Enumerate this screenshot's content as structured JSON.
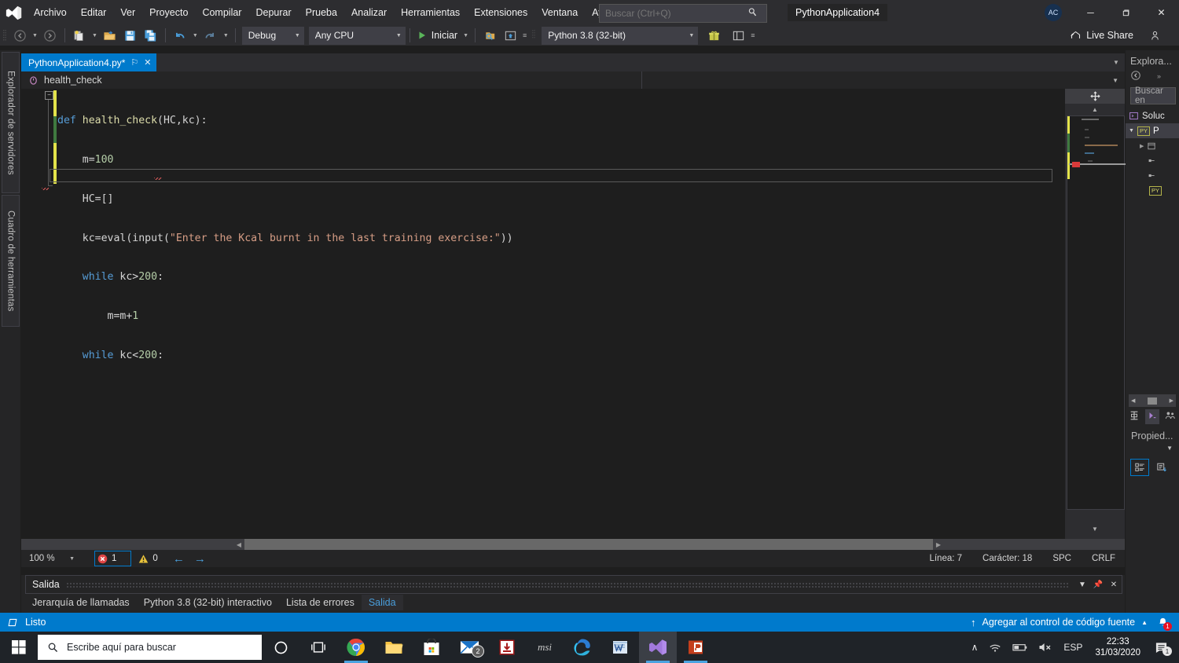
{
  "titlebar": {
    "logo_icon": "visual-studio-logo",
    "menus": [
      "Archivo",
      "Editar",
      "Ver",
      "Proyecto",
      "Compilar",
      "Depurar",
      "Prueba",
      "Analizar",
      "Herramientas",
      "Extensiones",
      "Ventana",
      "Ayuda"
    ],
    "search_placeholder": "Buscar (Ctrl+Q)",
    "search_value": "",
    "solution_name": "PythonApplication4",
    "account_initials": "AC",
    "minimize": "─",
    "restore": "❐",
    "close": "✕"
  },
  "toolbar": {
    "back_title": "Navegar hacia atrás",
    "forward_title": "Navegar hacia delante",
    "config": "Debug",
    "platform": "Any CPU",
    "start_label": "Iniciar",
    "interpreter": "Python 3.8 (32-bit)",
    "live_share": "Live Share"
  },
  "left_rail": {
    "tabs": [
      "Explorador de servidores",
      "Cuadro de herramientas"
    ]
  },
  "editor": {
    "tab_name": "PythonApplication4.py*",
    "tab_pin": "⚐",
    "tab_close": "✕",
    "breadcrumb_scope": "health_check",
    "code_lines": [
      {
        "indent": 0,
        "tokens": [
          {
            "t": "def ",
            "c": "kw"
          },
          {
            "t": "health_check",
            "c": "fn"
          },
          {
            "t": "(HC,kc):",
            "c": ""
          }
        ]
      },
      {
        "indent": 1,
        "tokens": [
          {
            "t": "m=",
            "c": ""
          },
          {
            "t": "100",
            "c": "num"
          }
        ]
      },
      {
        "indent": 1,
        "tokens": [
          {
            "t": "HC=[]",
            "c": ""
          }
        ]
      },
      {
        "indent": 1,
        "tokens": [
          {
            "t": "kc=eval(input(",
            "c": ""
          },
          {
            "t": "\"Enter the Kcal burnt in the last training exercise:\"",
            "c": "str"
          },
          {
            "t": "))",
            "c": ""
          }
        ]
      },
      {
        "indent": 1,
        "tokens": [
          {
            "t": "while ",
            "c": "kw"
          },
          {
            "t": "kc>",
            "c": ""
          },
          {
            "t": "200",
            "c": "num"
          },
          {
            "t": ":",
            "c": ""
          }
        ]
      },
      {
        "indent": 2,
        "tokens": [
          {
            "t": "m=m+",
            "c": ""
          },
          {
            "t": "1",
            "c": "num"
          }
        ]
      },
      {
        "indent": 1,
        "tokens": [
          {
            "t": "while ",
            "c": "kw"
          },
          {
            "t": "kc<",
            "c": ""
          },
          {
            "t": "200",
            "c": "num"
          },
          {
            "t": ":",
            "c": ""
          }
        ]
      }
    ],
    "zoom": "100 %",
    "error_count": "1",
    "warning_count": "0",
    "line_status": "Línea: 7",
    "char_status": "Carácter: 18",
    "spaces_status": "SPC",
    "eol_status": "CRLF"
  },
  "output_panel": {
    "title": "Salida",
    "dropdown_icon": "chevron-down-icon",
    "pin_icon": "pin-icon",
    "close_icon": "close-icon",
    "tabs": [
      "Jerarquía de llamadas",
      "Python 3.8 (32-bit) interactivo",
      "Lista de errores",
      "Salida"
    ],
    "active_tab": "Salida"
  },
  "right_dock": {
    "explorer_title": "Explora...",
    "search_placeholder": "Buscar en",
    "solution_row": "Soluc",
    "project_row": "P",
    "project_badge": "PY",
    "child_rows": [
      "",
      "",
      "",
      ""
    ],
    "properties_title": "Propied..."
  },
  "status_bar": {
    "ready": "Listo",
    "source_control": "Agregar al control de código fuente",
    "notification_count": "1"
  },
  "taskbar": {
    "start_icon": "windows-start-icon",
    "search_placeholder": "Escribe aquí para buscar",
    "cortana_icon": "cortana-circle-icon",
    "taskview_icon": "task-view-icon",
    "apps": [
      {
        "name": "chrome",
        "label": "Google Chrome",
        "badge": ""
      },
      {
        "name": "file-explorer",
        "label": "Explorador de archivos",
        "badge": ""
      },
      {
        "name": "microsoft-store",
        "label": "Microsoft Store",
        "badge": ""
      },
      {
        "name": "mail",
        "label": "Correo",
        "badge": "2"
      },
      {
        "name": "download-manager",
        "label": "Descargas",
        "badge": ""
      },
      {
        "name": "msi",
        "label": "MSI Center",
        "badge": ""
      },
      {
        "name": "edge",
        "label": "Microsoft Edge",
        "badge": ""
      },
      {
        "name": "word",
        "label": "Word",
        "badge": ""
      },
      {
        "name": "visual-studio",
        "label": "Visual Studio",
        "badge": ""
      },
      {
        "name": "powerpoint",
        "label": "PowerPoint",
        "badge": ""
      }
    ],
    "tray": {
      "chevron": "∧",
      "network_icon": "wifi-icon",
      "battery_icon": "battery-icon",
      "volume_icon": "volume-muted-icon",
      "language": "ESP",
      "time": "22:33",
      "date": "31/03/2020",
      "action_center_badge": "1"
    }
  },
  "colors": {
    "accent": "#007acc",
    "titlebar_bg": "#2d2d30",
    "editor_bg": "#1e1e1e",
    "panel_bg": "#252526",
    "keyword": "#569cd6",
    "string": "#d69d85",
    "number": "#b5cea8",
    "function": "#dcdcaa",
    "error_red": "#e81123",
    "taskbar_bg": "#1f2328"
  }
}
